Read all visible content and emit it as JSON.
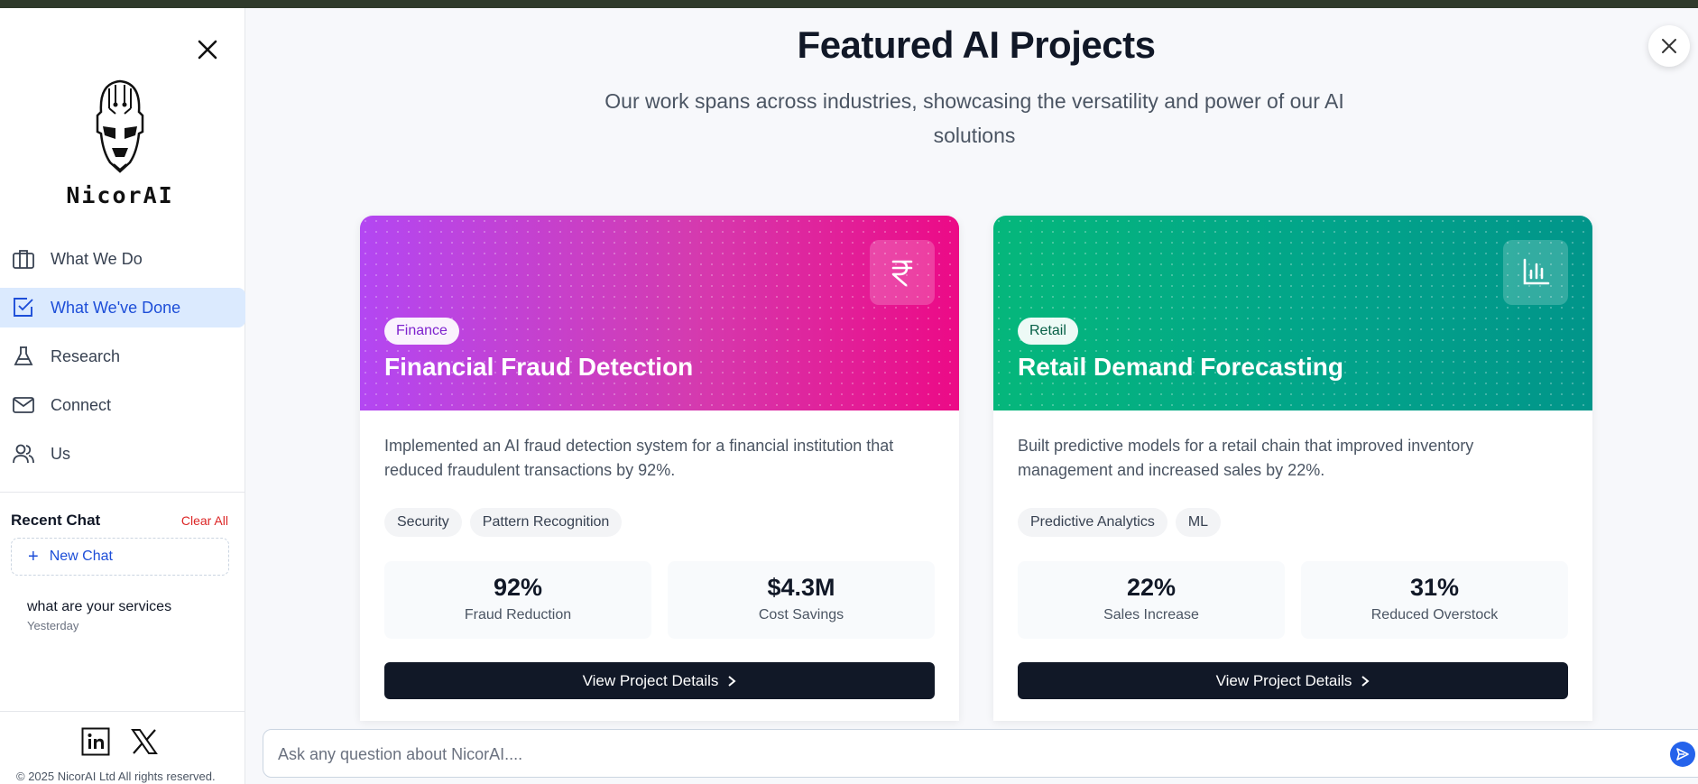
{
  "brand": {
    "name": "NicorAI"
  },
  "sidebar": {
    "nav": [
      {
        "label": "What We Do",
        "icon": "briefcase-icon"
      },
      {
        "label": "What We've Done",
        "icon": "checkbox-icon",
        "active": true
      },
      {
        "label": "Research",
        "icon": "flask-icon"
      },
      {
        "label": "Connect",
        "icon": "mail-icon"
      },
      {
        "label": "Us",
        "icon": "users-icon"
      }
    ],
    "recent_title": "Recent Chat",
    "clear_all": "Clear All",
    "new_chat": "New Chat",
    "chats": [
      {
        "title": "what are your services",
        "time": "Yesterday"
      }
    ],
    "copyright": "© 2025 NicorAI Ltd All rights reserved."
  },
  "main": {
    "title": "Featured AI Projects",
    "subtitle": "Our work spans across industries, showcasing the versatility and power of our AI solutions",
    "projects": [
      {
        "category": "Finance",
        "title": "Financial Fraud Detection",
        "icon": "rupee-icon",
        "description": "Implemented an AI fraud detection system for a financial institution that reduced fraudulent transactions by 92%.",
        "tags": [
          "Security",
          "Pattern Recognition"
        ],
        "stats": [
          {
            "value": "92%",
            "label": "Fraud Reduction"
          },
          {
            "value": "$4.3M",
            "label": "Cost Savings"
          }
        ],
        "cta": "View Project Details",
        "colors": [
          "#b347f2",
          "#ec0a86"
        ]
      },
      {
        "category": "Retail",
        "title": "Retail Demand Forecasting",
        "icon": "bar-chart-icon",
        "description": "Built predictive models for a retail chain that improved inventory management and increased sales by 22%.",
        "tags": [
          "Predictive Analytics",
          "ML"
        ],
        "stats": [
          {
            "value": "22%",
            "label": "Sales Increase"
          },
          {
            "value": "31%",
            "label": "Reduced Overstock"
          }
        ],
        "cta": "View Project Details",
        "colors": [
          "#05b77b",
          "#01958a"
        ]
      }
    ]
  },
  "chat_input": {
    "placeholder": "Ask any question about NicorAI...."
  }
}
